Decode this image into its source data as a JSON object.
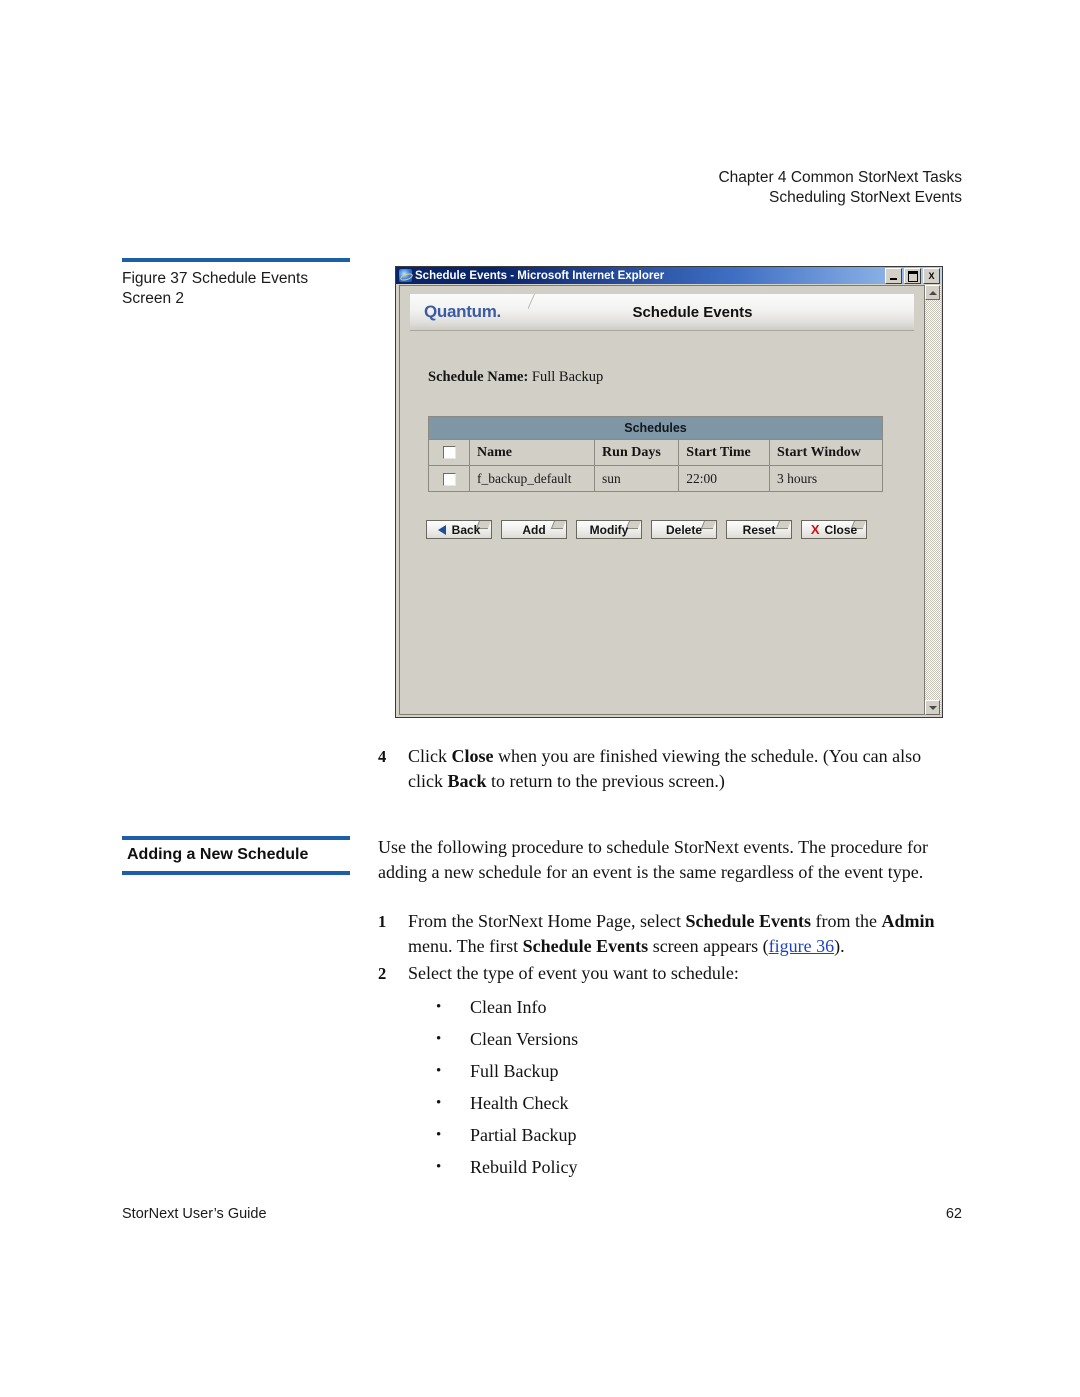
{
  "running_head": {
    "line1": "Chapter 4  Common StorNext Tasks",
    "line2": "Scheduling StorNext Events"
  },
  "figure": {
    "caption_line1": "Figure 37  Schedule Events",
    "caption_line2": "Screen 2",
    "rule_color": "#1b5fa8"
  },
  "browser": {
    "title": "Schedule Events - Microsoft Internet Explorer",
    "window_buttons": {
      "minimize": "minimize-button",
      "maximize": "maximize-button",
      "close": "X"
    },
    "banner": {
      "logo": "Quantum.",
      "title": "Schedule Events"
    },
    "schedule_name_label": "Schedule Name:",
    "schedule_name_value": "Full Backup",
    "table": {
      "band_title": "Schedules",
      "columns": [
        "",
        "Name",
        "Run Days",
        "Start Time",
        "Start Window"
      ],
      "rows": [
        {
          "name": "f_backup_default",
          "run_days": "sun",
          "start_time": "22:00",
          "start_window": "3 hours"
        }
      ]
    },
    "buttons": [
      {
        "label": "Back",
        "icon": "left-triangle-icon"
      },
      {
        "label": "Add",
        "icon": ""
      },
      {
        "label": "Modify",
        "icon": ""
      },
      {
        "label": "Delete",
        "icon": ""
      },
      {
        "label": "Reset",
        "icon": ""
      },
      {
        "label": "Close",
        "icon": "red-x-icon"
      }
    ]
  },
  "steps": {
    "step4": {
      "num": "4",
      "p1": "Click ",
      "b1": "Close",
      "p2": " when you are finished viewing the schedule. (You can also click ",
      "b2": "Back",
      "p3": " to return to the previous screen.)"
    },
    "step1": {
      "num": "1",
      "p1": "From the StorNext Home Page, select ",
      "b1": "Schedule Events",
      "p2": " from the ",
      "b2": "Admin",
      "p3": " menu. The first ",
      "b3": "Schedule Events",
      "p4": " screen appears (",
      "link": "figure 36",
      "p5": ")."
    },
    "step2": {
      "num": "2",
      "text": "Select the type of event you want to schedule:"
    }
  },
  "section": {
    "heading": "Adding a New Schedule",
    "intro": "Use the following procedure to schedule StorNext events. The procedure for adding a new schedule for an event is the same regardless of the event type."
  },
  "event_types": [
    "Clean Info",
    "Clean Versions",
    "Full Backup",
    "Health Check",
    "Partial Backup",
    "Rebuild Policy"
  ],
  "bullet_glyph": "•",
  "footer": {
    "left": "StorNext User’s Guide",
    "right": "62"
  }
}
